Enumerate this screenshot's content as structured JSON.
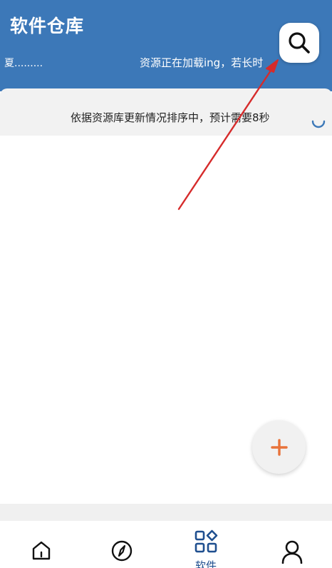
{
  "header": {
    "title": "软件仓库",
    "ticker_left": "夏.........",
    "ticker_right": "资源正在加载ing，若长时",
    "search_icon": "search-icon",
    "background": "#3c78b8"
  },
  "status": {
    "text": "依据资源库更新情况排序中，预计需要8秒",
    "spinner_icon": "loading-spinner-icon"
  },
  "fab": {
    "icon": "plus-icon",
    "color": "#e8733a"
  },
  "bottom_nav": {
    "items": [
      {
        "name": "home",
        "icon": "home-icon",
        "label": ""
      },
      {
        "name": "discover",
        "icon": "compass-icon",
        "label": ""
      },
      {
        "name": "software",
        "icon": "apps-grid-icon",
        "label": "软件"
      },
      {
        "name": "profile",
        "icon": "person-icon",
        "label": ""
      }
    ],
    "active_color": "#1f4f8f"
  },
  "annotation": {
    "arrow_color": "#d62b2b"
  }
}
